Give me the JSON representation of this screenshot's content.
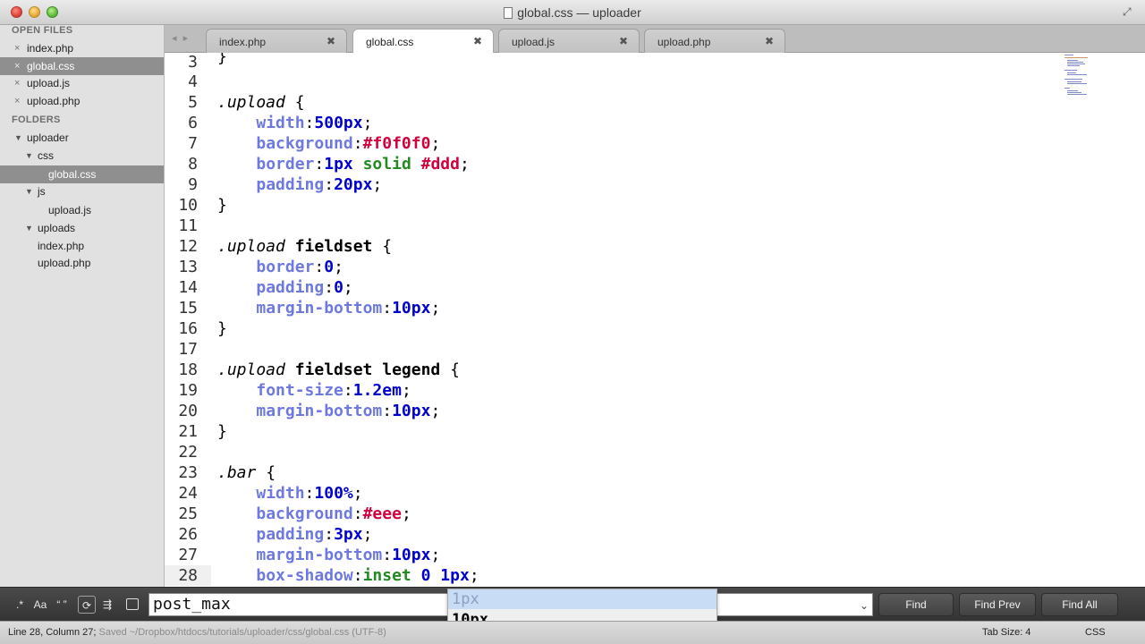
{
  "window": {
    "title": "global.css — uploader"
  },
  "sidebar": {
    "open_files_heading": "OPEN FILES",
    "open_files": [
      {
        "name": "index.php",
        "selected": false
      },
      {
        "name": "global.css",
        "selected": true
      },
      {
        "name": "upload.js",
        "selected": false
      },
      {
        "name": "upload.php",
        "selected": false
      }
    ],
    "folders_heading": "FOLDERS",
    "tree": [
      {
        "name": "uploader",
        "expanded": true,
        "selected": false
      },
      {
        "name": "css",
        "expanded": true,
        "selected": false
      },
      {
        "name": "global.css",
        "selected": true
      },
      {
        "name": "js",
        "expanded": true,
        "selected": false
      },
      {
        "name": "upload.js",
        "selected": false
      },
      {
        "name": "uploads",
        "expanded": true,
        "selected": false
      },
      {
        "name": "index.php",
        "selected": false
      },
      {
        "name": "upload.php",
        "selected": false
      }
    ]
  },
  "tabs": [
    {
      "label": "index.php",
      "active": false
    },
    {
      "label": "global.css",
      "active": true
    },
    {
      "label": "upload.js",
      "active": false
    },
    {
      "label": "upload.php",
      "active": false
    }
  ],
  "editor": {
    "line_numbers": [
      "3",
      "4",
      "5",
      "6",
      "7",
      "8",
      "9",
      "10",
      "11",
      "12",
      "13",
      "14",
      "15",
      "16",
      "17",
      "18",
      "19",
      "20",
      "21",
      "22",
      "23",
      "24",
      "25",
      "26",
      "27",
      "28"
    ],
    "current_line": "28"
  },
  "findbar": {
    "options": [
      ".*",
      "Aa",
      "“ ”"
    ],
    "query": "post_max",
    "buttons": {
      "find": "Find",
      "find_prev": "Find Prev",
      "find_all": "Find All"
    }
  },
  "autocomplete": {
    "items": [
      {
        "text": "1px",
        "highlighted": true
      },
      {
        "prefix": "1",
        "text": "0px",
        "highlighted": false
      }
    ]
  },
  "statusbar": {
    "position": "Line 28, Column 27;",
    "saved": "Saved ~/Dropbox/htdocs/tutorials/uploader/css/global.css (UTF-8)",
    "tab_size": "Tab Size: 4",
    "syntax": "CSS"
  },
  "colors": {
    "property": "#6d79de",
    "number": "#0000cd",
    "color_value": "#d2003c",
    "keyword_value": "#228b22",
    "selection": "#8f8f8f"
  }
}
